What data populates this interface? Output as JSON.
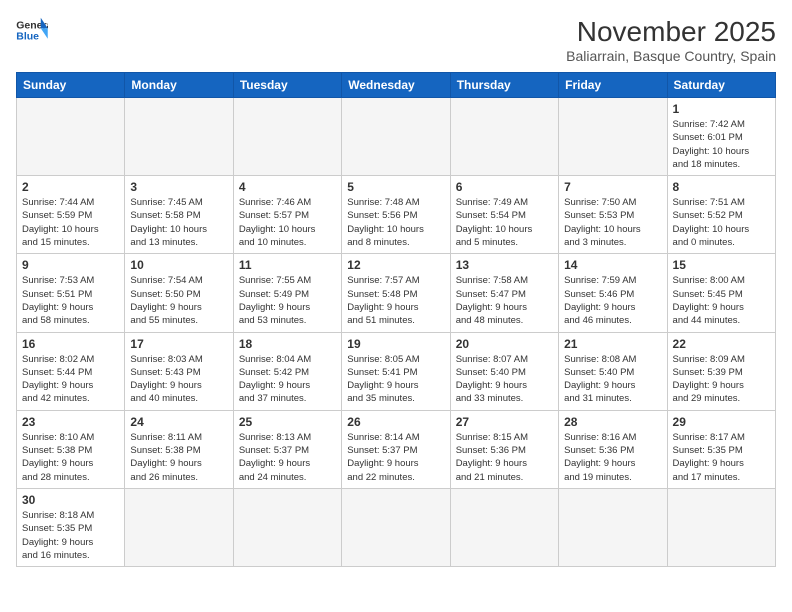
{
  "header": {
    "logo_line1": "General",
    "logo_line2": "Blue",
    "month": "November 2025",
    "location": "Baliarrain, Basque Country, Spain"
  },
  "weekdays": [
    "Sunday",
    "Monday",
    "Tuesday",
    "Wednesday",
    "Thursday",
    "Friday",
    "Saturday"
  ],
  "weeks": [
    [
      {
        "day": "",
        "info": ""
      },
      {
        "day": "",
        "info": ""
      },
      {
        "day": "",
        "info": ""
      },
      {
        "day": "",
        "info": ""
      },
      {
        "day": "",
        "info": ""
      },
      {
        "day": "",
        "info": ""
      },
      {
        "day": "1",
        "info": "Sunrise: 7:42 AM\nSunset: 6:01 PM\nDaylight: 10 hours\nand 18 minutes."
      }
    ],
    [
      {
        "day": "2",
        "info": "Sunrise: 7:44 AM\nSunset: 5:59 PM\nDaylight: 10 hours\nand 15 minutes."
      },
      {
        "day": "3",
        "info": "Sunrise: 7:45 AM\nSunset: 5:58 PM\nDaylight: 10 hours\nand 13 minutes."
      },
      {
        "day": "4",
        "info": "Sunrise: 7:46 AM\nSunset: 5:57 PM\nDaylight: 10 hours\nand 10 minutes."
      },
      {
        "day": "5",
        "info": "Sunrise: 7:48 AM\nSunset: 5:56 PM\nDaylight: 10 hours\nand 8 minutes."
      },
      {
        "day": "6",
        "info": "Sunrise: 7:49 AM\nSunset: 5:54 PM\nDaylight: 10 hours\nand 5 minutes."
      },
      {
        "day": "7",
        "info": "Sunrise: 7:50 AM\nSunset: 5:53 PM\nDaylight: 10 hours\nand 3 minutes."
      },
      {
        "day": "8",
        "info": "Sunrise: 7:51 AM\nSunset: 5:52 PM\nDaylight: 10 hours\nand 0 minutes."
      }
    ],
    [
      {
        "day": "9",
        "info": "Sunrise: 7:53 AM\nSunset: 5:51 PM\nDaylight: 9 hours\nand 58 minutes."
      },
      {
        "day": "10",
        "info": "Sunrise: 7:54 AM\nSunset: 5:50 PM\nDaylight: 9 hours\nand 55 minutes."
      },
      {
        "day": "11",
        "info": "Sunrise: 7:55 AM\nSunset: 5:49 PM\nDaylight: 9 hours\nand 53 minutes."
      },
      {
        "day": "12",
        "info": "Sunrise: 7:57 AM\nSunset: 5:48 PM\nDaylight: 9 hours\nand 51 minutes."
      },
      {
        "day": "13",
        "info": "Sunrise: 7:58 AM\nSunset: 5:47 PM\nDaylight: 9 hours\nand 48 minutes."
      },
      {
        "day": "14",
        "info": "Sunrise: 7:59 AM\nSunset: 5:46 PM\nDaylight: 9 hours\nand 46 minutes."
      },
      {
        "day": "15",
        "info": "Sunrise: 8:00 AM\nSunset: 5:45 PM\nDaylight: 9 hours\nand 44 minutes."
      }
    ],
    [
      {
        "day": "16",
        "info": "Sunrise: 8:02 AM\nSunset: 5:44 PM\nDaylight: 9 hours\nand 42 minutes."
      },
      {
        "day": "17",
        "info": "Sunrise: 8:03 AM\nSunset: 5:43 PM\nDaylight: 9 hours\nand 40 minutes."
      },
      {
        "day": "18",
        "info": "Sunrise: 8:04 AM\nSunset: 5:42 PM\nDaylight: 9 hours\nand 37 minutes."
      },
      {
        "day": "19",
        "info": "Sunrise: 8:05 AM\nSunset: 5:41 PM\nDaylight: 9 hours\nand 35 minutes."
      },
      {
        "day": "20",
        "info": "Sunrise: 8:07 AM\nSunset: 5:40 PM\nDaylight: 9 hours\nand 33 minutes."
      },
      {
        "day": "21",
        "info": "Sunrise: 8:08 AM\nSunset: 5:40 PM\nDaylight: 9 hours\nand 31 minutes."
      },
      {
        "day": "22",
        "info": "Sunrise: 8:09 AM\nSunset: 5:39 PM\nDaylight: 9 hours\nand 29 minutes."
      }
    ],
    [
      {
        "day": "23",
        "info": "Sunrise: 8:10 AM\nSunset: 5:38 PM\nDaylight: 9 hours\nand 28 minutes."
      },
      {
        "day": "24",
        "info": "Sunrise: 8:11 AM\nSunset: 5:38 PM\nDaylight: 9 hours\nand 26 minutes."
      },
      {
        "day": "25",
        "info": "Sunrise: 8:13 AM\nSunset: 5:37 PM\nDaylight: 9 hours\nand 24 minutes."
      },
      {
        "day": "26",
        "info": "Sunrise: 8:14 AM\nSunset: 5:37 PM\nDaylight: 9 hours\nand 22 minutes."
      },
      {
        "day": "27",
        "info": "Sunrise: 8:15 AM\nSunset: 5:36 PM\nDaylight: 9 hours\nand 21 minutes."
      },
      {
        "day": "28",
        "info": "Sunrise: 8:16 AM\nSunset: 5:36 PM\nDaylight: 9 hours\nand 19 minutes."
      },
      {
        "day": "29",
        "info": "Sunrise: 8:17 AM\nSunset: 5:35 PM\nDaylight: 9 hours\nand 17 minutes."
      }
    ],
    [
      {
        "day": "30",
        "info": "Sunrise: 8:18 AM\nSunset: 5:35 PM\nDaylight: 9 hours\nand 16 minutes."
      },
      {
        "day": "",
        "info": ""
      },
      {
        "day": "",
        "info": ""
      },
      {
        "day": "",
        "info": ""
      },
      {
        "day": "",
        "info": ""
      },
      {
        "day": "",
        "info": ""
      },
      {
        "day": "",
        "info": ""
      }
    ]
  ]
}
